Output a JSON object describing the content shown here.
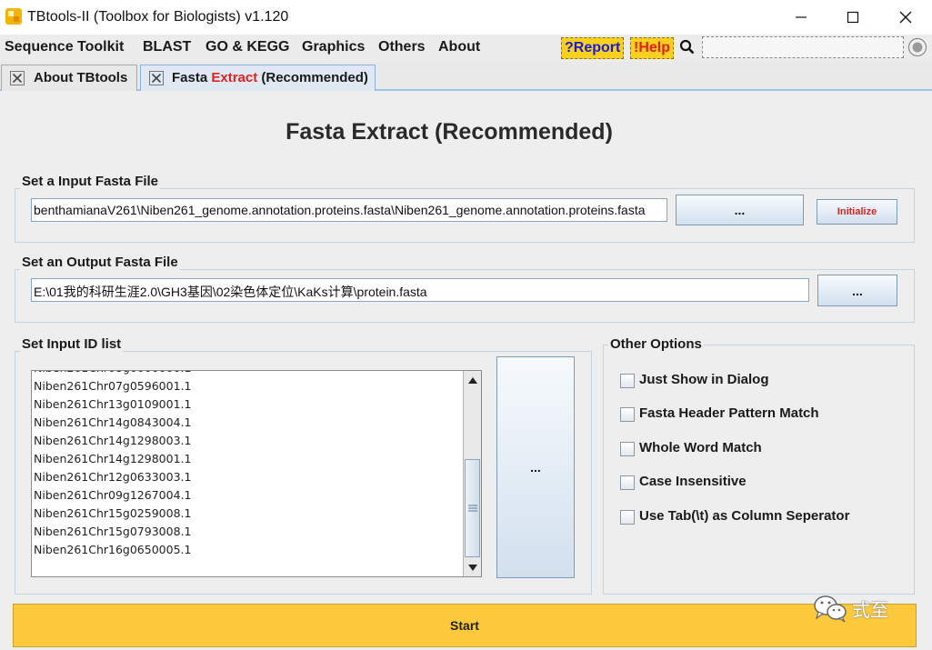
{
  "window": {
    "title": "TBtools-II (Toolbox for Biologists) v1.120"
  },
  "menu": {
    "items": [
      "Sequence Toolkit",
      "BLAST",
      "GO & KEGG",
      "Graphics",
      "Others",
      "About"
    ],
    "report_label": "?Report",
    "help_label": "!Help",
    "search_placeholder": ""
  },
  "tabs": [
    {
      "label": "About TBtools",
      "active": false
    },
    {
      "label_prefix": "Fasta ",
      "label_highlight": "Extract",
      "label_suffix": " (Recommended)",
      "active": true
    }
  ],
  "panel": {
    "heading": "Fasta Extract (Recommended)",
    "input_group": {
      "title": "Set a Input Fasta File",
      "value": "benthamianaV261\\Niben261_genome.annotation.proteins.fasta\\Niben261_genome.annotation.proteins.fasta",
      "browse_label": "...",
      "initialize_label": "Initialize"
    },
    "output_group": {
      "title": "Set an Output Fasta File",
      "value": "E:\\01我的科研生涯2.0\\GH3基因\\02染色体定位\\KaKs计算\\protein.fasta",
      "browse_label": "..."
    },
    "id_group": {
      "title": "Set Input ID list",
      "ids": [
        "Niben261Chr07g0596001.1",
        "Niben261Chr13g0109001.1",
        "Niben261Chr14g0843004.1",
        "Niben261Chr14g1298003.1",
        "Niben261Chr14g1298001.1",
        "Niben261Chr12g0633003.1",
        "Niben261Chr09g1267004.1",
        "Niben261Chr15g0259008.1",
        "Niben261Chr15g0793008.1",
        "Niben261Chr16g0650005.1"
      ],
      "browse_label": "..."
    },
    "options_group": {
      "title": "Other Options",
      "options": [
        {
          "label": "Just Show in Dialog",
          "checked": false
        },
        {
          "label": "Fasta Header Pattern Match",
          "checked": false
        },
        {
          "label": "Whole Word Match",
          "checked": false
        },
        {
          "label": "Case Insensitive",
          "checked": false
        },
        {
          "label": "Use Tab(\\t) as Column Seperator",
          "checked": false
        }
      ]
    },
    "start_label": "Start"
  },
  "watermark": {
    "text": "式至"
  },
  "colors": {
    "accent_yellow": "#fcc93c",
    "badge_yellow": "#f7d020",
    "highlight_red": "#e2211c",
    "report_blue": "#1b1bd6"
  }
}
